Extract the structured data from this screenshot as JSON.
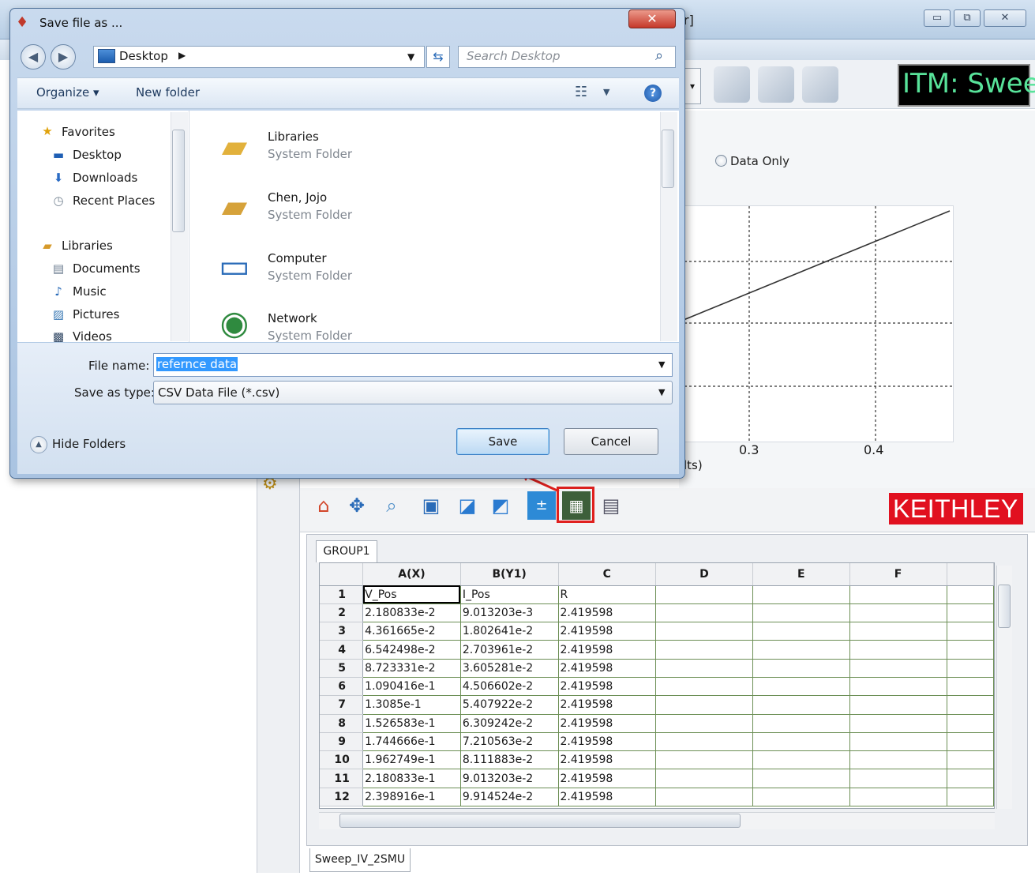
{
  "background_app": {
    "title_fragment": "r]",
    "window_buttons": {
      "minimize": "▭",
      "restore": "⧉",
      "close": "✕"
    },
    "itm_banner": "ITM: Swee",
    "radio_data_only": "Data Only",
    "plot": {
      "x_ticks": [
        "0.3",
        "0.4"
      ],
      "x_label_fragment": "lts)"
    },
    "keithley_logo": "KEITHLEY",
    "sheet_tab": "GROUP1",
    "bottom_tab": "Sweep_IV_2SMU",
    "grid": {
      "columns": [
        "",
        "A(X)",
        "B(Y1)",
        "C",
        "D",
        "E",
        "F",
        ""
      ],
      "rows": [
        [
          "1",
          "V_Pos",
          "I_Pos",
          "R"
        ],
        [
          "2",
          "2.180833e-2",
          "9.013203e-3",
          "2.419598"
        ],
        [
          "3",
          "4.361665e-2",
          "1.802641e-2",
          "2.419598"
        ],
        [
          "4",
          "6.542498e-2",
          "2.703961e-2",
          "2.419598"
        ],
        [
          "5",
          "8.723331e-2",
          "3.605281e-2",
          "2.419598"
        ],
        [
          "6",
          "1.090416e-1",
          "4.506602e-2",
          "2.419598"
        ],
        [
          "7",
          "1.3085e-1",
          "5.407922e-2",
          "2.419598"
        ],
        [
          "8",
          "1.526583e-1",
          "6.309242e-2",
          "2.419598"
        ],
        [
          "9",
          "1.744666e-1",
          "7.210563e-2",
          "2.419598"
        ],
        [
          "10",
          "1.962749e-1",
          "8.111883e-2",
          "2.419598"
        ],
        [
          "11",
          "2.180833e-1",
          "9.013203e-2",
          "2.419598"
        ],
        [
          "12",
          "2.398916e-1",
          "9.914524e-2",
          "2.419598"
        ]
      ]
    },
    "plot_toolbar_icons": [
      "home-icon",
      "move-icon",
      "zoom-icon",
      "save-plot-icon",
      "line-plot-icon",
      "axis-icon",
      "calculator-icon",
      "export-data-icon",
      "notes-icon"
    ]
  },
  "dialog": {
    "title": "Save file as ...",
    "close_label": "✕",
    "address": "Desktop",
    "search_placeholder": "Search Desktop",
    "organize_label": "Organize ▾",
    "new_folder_label": "New folder",
    "help_label": "?",
    "nav": {
      "favorites": "Favorites",
      "desktop": "Desktop",
      "downloads": "Downloads",
      "recent": "Recent Places",
      "libraries": "Libraries",
      "documents": "Documents",
      "music": "Music",
      "pictures": "Pictures",
      "videos": "Videos"
    },
    "files": [
      {
        "name": "Libraries",
        "type": "System Folder",
        "icon": "libraries-folder-icon"
      },
      {
        "name": "Chen, Jojo",
        "type": "System Folder",
        "icon": "user-folder-icon"
      },
      {
        "name": "Computer",
        "type": "System Folder",
        "icon": "computer-icon"
      },
      {
        "name": "Network",
        "type": "System Folder",
        "icon": "network-icon"
      }
    ],
    "file_name_label": "File name:",
    "file_name_value": "refernce data",
    "save_type_label": "Save as type:",
    "save_type_value": "CSV Data File (*.csv)",
    "hide_folders_label": "Hide Folders",
    "save_button": "Save",
    "cancel_button": "Cancel"
  },
  "colors": {
    "itm_text": "#58e39a",
    "keithley_red": "#e1101f",
    "highlight_red": "#e0201e",
    "grid_lines": "#6c8f55",
    "selection_blue": "#3399ff"
  }
}
